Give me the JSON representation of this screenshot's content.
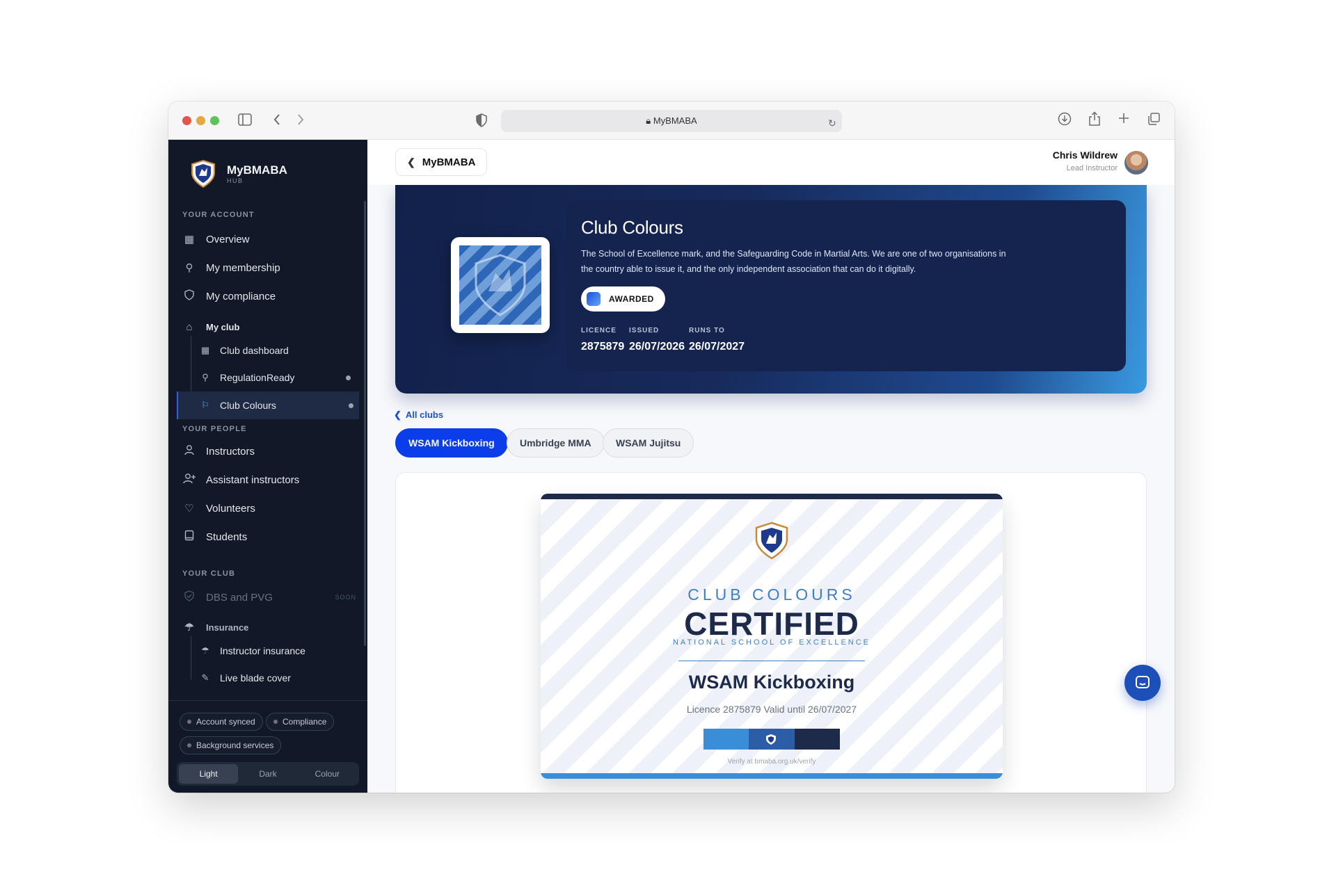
{
  "browser": {
    "url": "MyBMABA"
  },
  "brand": {
    "name": "MyBMABA",
    "sub": "HUB"
  },
  "sidebar": {
    "sec_account": "YOUR ACCOUNT",
    "overview": "Overview",
    "membership": "My membership",
    "compliance": "My compliance",
    "my_club": "My club",
    "club_dashboard": "Club dashboard",
    "regulation_ready": "RegulationReady",
    "club_colours": "Club Colours",
    "sec_people": "YOUR PEOPLE",
    "instructors": "Instructors",
    "assistant_instructors": "Assistant instructors",
    "volunteers": "Volunteers",
    "students": "Students",
    "sec_club": "YOUR CLUB",
    "dbs": "DBS and PVG",
    "dbs_badge": "SOON",
    "insurance": "Insurance",
    "instructor_insurance": "Instructor insurance",
    "live_blade": "Live blade cover"
  },
  "status": {
    "synced": "Account synced",
    "compliance": "Compliance",
    "background": "Background services"
  },
  "theme": {
    "light": "Light",
    "dark": "Dark",
    "colour": "Colour"
  },
  "topbar": {
    "back_label": "MyBMABA",
    "user_name": "Chris Wildrew",
    "user_role": "Lead Instructor"
  },
  "hero": {
    "title": "Club Colours",
    "description": "The School of Excellence mark, and the Safeguarding Code in Martial Arts. We are one of two organisations in the country able to issue it, and the only independent association that can do it digitally.",
    "status": "AWARDED",
    "licence_label": "LICENCE",
    "licence": "2875879",
    "issued_label": "ISSUED",
    "issued": "26/07/2026",
    "runs_label": "RUNS TO",
    "runs_to": "26/07/2027"
  },
  "clubs": {
    "all_label": "All clubs",
    "tabs": [
      "WSAM Kickboxing",
      "Umbridge MMA",
      "WSAM Jujitsu"
    ]
  },
  "certificate": {
    "subtitle": "CLUB COLOURS",
    "title": "CERTIFIED",
    "national": "NATIONAL SCHOOL OF EXCELLENCE",
    "club": "WSAM Kickboxing",
    "licence_line": "Licence 2875879 Valid until 26/07/2027",
    "verify": "Verify at bmaba.org.uk/verify"
  },
  "colors": {
    "accent": "#0b3ee8",
    "sidebar_bg": "#111827",
    "navy": "#1e2a4a",
    "light_blue": "#3a8ed8"
  }
}
